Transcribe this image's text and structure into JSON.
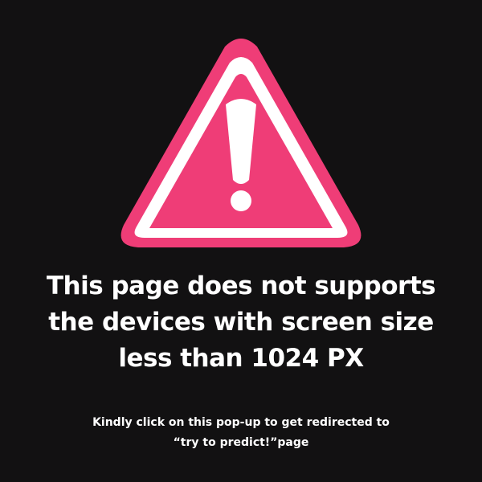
{
  "popup": {
    "icon": "warning-triangle-icon",
    "headline_lines": [
      "This page does not supports",
      "the devices with screen size",
      "less than 1024 PX"
    ],
    "subtext_lines": [
      "Kindly click on this pop-up to get redirected to",
      "“try to predict!”page"
    ]
  },
  "colors": {
    "background": "#121112",
    "accent": "#ef3d77",
    "icon_outline": "#ffffff",
    "text": "#ffffff"
  }
}
